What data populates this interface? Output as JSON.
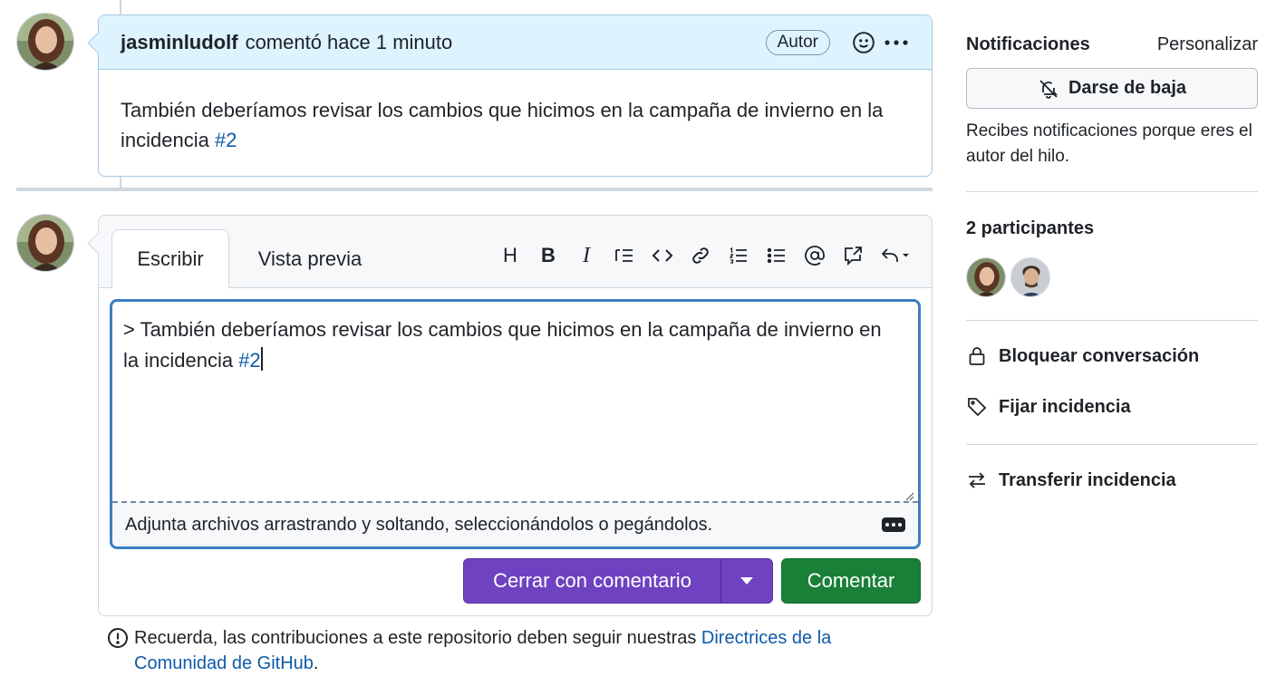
{
  "comment": {
    "author": "jasminludolf",
    "meta": "comentó hace 1 minuto",
    "badge": "Autor",
    "body_text": "También deberíamos revisar los cambios que hicimos en la campaña de invierno en la incidencia ",
    "body_link": "#2"
  },
  "editor": {
    "tab_write": "Escribir",
    "tab_preview": "Vista previa",
    "toolbar": {
      "heading": "H",
      "bold": "B",
      "italic": "I"
    },
    "text_value": "> También deberíamos revisar los cambios que hicimos en la campaña de invierno en la incidencia ",
    "text_link": "#2",
    "attach_hint": "Adjunta archivos arrastrando y soltando, seleccionándolos o pegándolos.",
    "close_button": "Cerrar con comentario",
    "comment_button": "Comentar"
  },
  "reminder": {
    "text": "Recuerda, las contribuciones a este repositorio deben seguir nuestras ",
    "link": "Directrices de la Comunidad de GitHub",
    "end": "."
  },
  "sidebar": {
    "notifications_title": "Notificaciones",
    "customize_link": "Personalizar",
    "unsubscribe_button": "Darse de baja",
    "notifications_reason": "Recibes notificaciones porque eres el autor del hilo.",
    "participants_title": "2 participantes",
    "lock_label": "Bloquear conversación",
    "pin_label": "Fijar incidencia",
    "transfer_label": "Transferir incidencia"
  },
  "colors": {
    "accent_link": "#0f5aa8",
    "close_button": "#6f42c1",
    "comment_button": "#1a7f37",
    "comment_header": "#ddf4ff",
    "focus_border": "#3c7fc2"
  },
  "icons": [
    "smiley-icon",
    "kebab-horizontal-icon",
    "bell-slash-icon",
    "lock-icon",
    "tag-icon",
    "arrow-switch-icon",
    "alert-icon"
  ]
}
